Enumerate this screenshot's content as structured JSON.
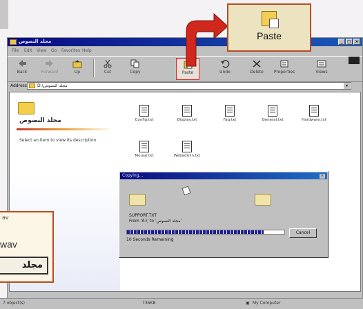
{
  "window": {
    "title": "مجلد النصوص",
    "menus": [
      "File",
      "Edit",
      "View",
      "Go",
      "Favorites",
      "Help"
    ]
  },
  "toolbar": {
    "buttons": [
      {
        "label": "Back",
        "icon": "back-arrow-icon"
      },
      {
        "label": "Forward",
        "icon": "forward-arrow-icon"
      },
      {
        "label": "Up",
        "icon": "up-folder-icon"
      },
      {
        "label": "Cut",
        "icon": "scissors-icon"
      },
      {
        "label": "Copy",
        "icon": "copy-icon"
      },
      {
        "label": "Paste",
        "icon": "paste-icon"
      },
      {
        "label": "Undo",
        "icon": "undo-icon"
      },
      {
        "label": "Delete",
        "icon": "delete-x-icon"
      },
      {
        "label": "Properties",
        "icon": "properties-icon"
      },
      {
        "label": "Views",
        "icon": "views-icon"
      }
    ]
  },
  "address": {
    "label": "Address",
    "value": "D:\\مجلد النصوص"
  },
  "left_pane": {
    "folder_title": "مجلد النصوص",
    "hint": "Select an item to view its description."
  },
  "files": [
    {
      "name": "Config.txt"
    },
    {
      "name": "Display.txt"
    },
    {
      "name": "Faq.txt"
    },
    {
      "name": "General.txt"
    },
    {
      "name": "Hardware.txt"
    },
    {
      "name": "Mouse.txt"
    },
    {
      "name": "Webadmin.txt"
    }
  ],
  "copy_dialog": {
    "title": "Copying...",
    "file": "SUPPORT.TXT",
    "path": "From 'A:\\' to 'مجلد النصوص'",
    "remaining": "10 Seconds Remaining",
    "cancel_label": "Cancel",
    "progress": 0.87
  },
  "status": {
    "objects": "7 object(s)",
    "size": "736KB",
    "location": "My Computer"
  },
  "callouts": {
    "paste_label": "Paste",
    "wav_small": "av",
    "wav_large": "wav",
    "wav_arabic": "مجلد"
  },
  "colors": {
    "arrow": "#d0281c",
    "callout_border": "#b84b22",
    "titlebar": "#0a0a80"
  }
}
